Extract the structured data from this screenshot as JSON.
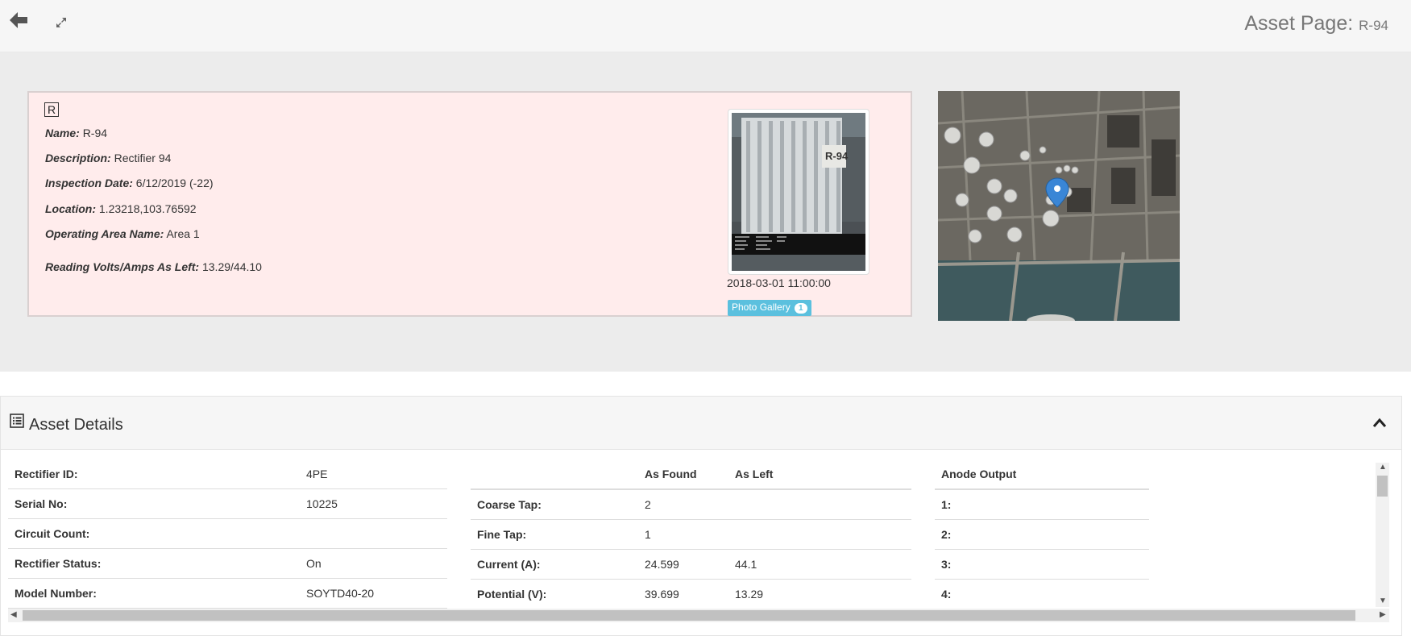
{
  "header": {
    "title": "Asset Page:",
    "asset_id": "R-94"
  },
  "asset_card": {
    "badge": "R",
    "name_label": "Name:",
    "name_value": "R-94",
    "description_label": "Description:",
    "description_value": "Rectifier 94",
    "inspection_label": "Inspection Date:",
    "inspection_value": "6/12/2019 (-22)",
    "location_label": "Location:",
    "location_value": "1.23218,103.76592",
    "area_label": "Operating Area Name:",
    "area_value": "Area 1",
    "reading_label": "Reading Volts/Amps As Left:",
    "reading_value": "13.29/44.10",
    "photo_timestamp": "2018-03-01 11:00:00",
    "photo_plate_text": "R-94",
    "gallery_label": "Photo Gallery",
    "gallery_count": "1"
  },
  "details": {
    "title": "Asset Details",
    "left_rows": [
      {
        "label": "Rectifier ID:",
        "value": "4PE"
      },
      {
        "label": "Serial No:",
        "value": "10225"
      },
      {
        "label": "Circuit Count:",
        "value": ""
      },
      {
        "label": "Rectifier Status:",
        "value": "On"
      },
      {
        "label": "Model Number:",
        "value": "SOYTD40-20"
      }
    ],
    "mid_headers": {
      "as_found": "As Found",
      "as_left": "As Left"
    },
    "mid_rows": [
      {
        "label": "Coarse Tap:",
        "found": "2",
        "left": ""
      },
      {
        "label": "Fine Tap:",
        "found": "1",
        "left": ""
      },
      {
        "label": "Current (A):",
        "found": "24.599",
        "left": "44.1"
      },
      {
        "label": "Potential (V):",
        "found": "39.699",
        "left": "13.29"
      }
    ],
    "anode_header": "Anode Output",
    "anode_rows": [
      "1:",
      "2:",
      "3:",
      "4:"
    ]
  },
  "colors": {
    "card_bg": "#ffecec",
    "gallery_btn": "#5bc0de",
    "map_pin": "#3a86d6"
  }
}
